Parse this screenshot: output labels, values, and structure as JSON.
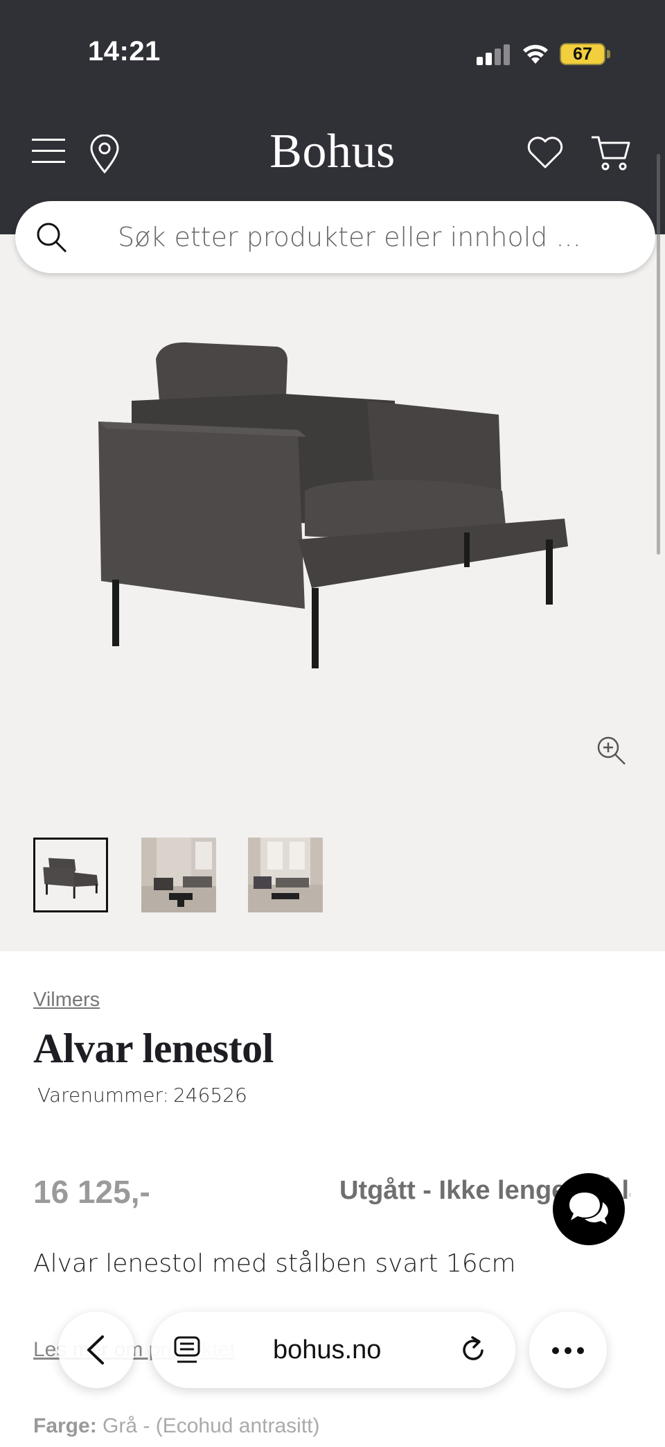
{
  "status_bar": {
    "time": "14:21",
    "battery": "67",
    "icons": [
      "signal-icon",
      "wifi-icon",
      "battery-icon"
    ]
  },
  "header": {
    "logo": "Bohus",
    "icons": [
      "menu-icon",
      "location-icon",
      "heart-icon",
      "cart-icon"
    ]
  },
  "search": {
    "placeholder": "Søk etter produkter eller innhold ...",
    "value": ""
  },
  "gallery": {
    "thumbnails": [
      "thumbnail-armchair",
      "thumbnail-livingroom-1",
      "thumbnail-livingroom-2"
    ],
    "active_index": 0
  },
  "product": {
    "brand": "Vilmers",
    "title": "Alvar lenestol",
    "sku_label": "Varenummer:",
    "sku": "246526",
    "price": "16 125,-",
    "stock_status": "Utgått - Ikke lenger på lag",
    "description": "Alvar lenestol med stålben svart 16cm",
    "read_more": "Les mer om produktet",
    "color_label": "Farge:",
    "color_value": "Grå - (Ecohud antrasitt)"
  },
  "browser": {
    "url": "bohus.no"
  },
  "colors": {
    "header_bg": "#303037",
    "gallery_bg": "#f3f1ef",
    "battery_yellow": "#f2cf3c",
    "chat_bg": "#000000"
  }
}
